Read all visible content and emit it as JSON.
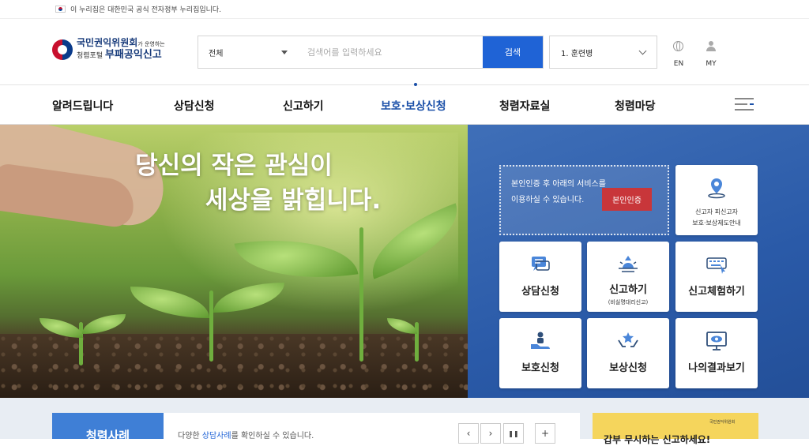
{
  "gov_bar": {
    "text": "이 누리집은 대한민국 공식 전자정부 누리집입니다."
  },
  "logo": {
    "line1": "국민권익위원회",
    "line1_suffix": "가 운영하는",
    "line2": "청렴포털",
    "line2_strong": "부패공익신고"
  },
  "search": {
    "scope": "전체",
    "placeholder": "검색어를 입력하세요",
    "button": "검색"
  },
  "trend": {
    "selected": "1. 훈련병"
  },
  "util": {
    "lang": "EN",
    "my": "MY"
  },
  "nav": {
    "items": [
      "알려드립니다",
      "상담신청",
      "신고하기",
      "보호·보상신청",
      "청렴자료실",
      "청렴마당"
    ],
    "active_index": 3
  },
  "hero": {
    "title_line1": "당신의 작은 관심이",
    "title_line2": "세상을 밝힙니다."
  },
  "auth": {
    "text": "본인인증 후 아래의 서비스를 이용하실 수 있습니다.",
    "button": "본인인증"
  },
  "quick": {
    "guide": {
      "line1": "신고자 피신고자",
      "line2": "보호·보상제도안내"
    },
    "consult": "상담신청",
    "report": "신고하기",
    "report_sub": "(비실명대리신고)",
    "experience": "신고체험하기",
    "protect": "보호신청",
    "reward": "보상신청",
    "results": "나의결과보기"
  },
  "bottom": {
    "tab": "청렴사례",
    "text_pre": "다양한 ",
    "text_link": "상담사례",
    "text_post": "를 확인하실 수 있습니다.",
    "prev": "‹",
    "next": "›",
    "pause": "❚❚",
    "more": "+",
    "banner_logo": "국민권익위원회",
    "banner_text": "갑부 무시하는 신고하세요!"
  },
  "colors": {
    "primary": "#1f63d6",
    "nav_active": "#1a4fa8",
    "auth_button": "#c8363a",
    "tab": "#3f7fd6",
    "banner": "#f5d55c"
  }
}
